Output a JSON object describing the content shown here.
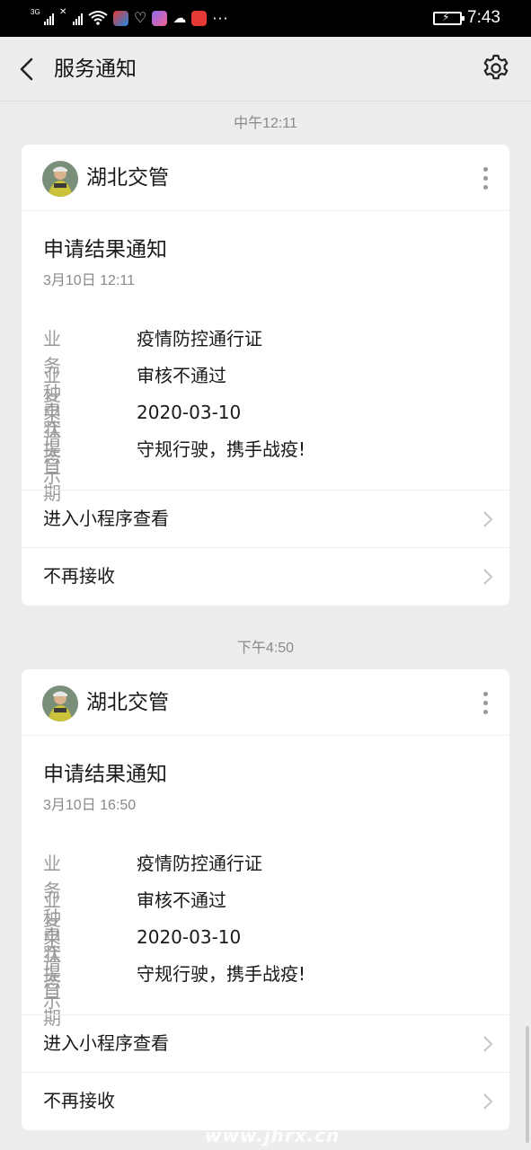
{
  "status_bar": {
    "network1": "3G",
    "network2": "4G",
    "time": "7:43",
    "more_glyph": "···"
  },
  "header": {
    "title": "服务通知",
    "back_icon": "back-chevron-icon",
    "settings_icon": "gear-icon"
  },
  "notifications": [
    {
      "timestamp": "中午12:11",
      "sender": "湖北交管",
      "title": "申请结果通知",
      "date": "3月10日  12:11",
      "fields": [
        {
          "key": "业务种类",
          "value": "疫情防控通行证"
        },
        {
          "key": "业务状态",
          "value": "审核不通过"
        },
        {
          "key": "申请日期",
          "value": "2020-03-10"
        },
        {
          "key": "提示",
          "value": "守规行驶，携手战疫!"
        }
      ],
      "action_view": "进入小程序查看",
      "action_unsubscribe": "不再接收"
    },
    {
      "timestamp": "下午4:50",
      "sender": "湖北交管",
      "title": "申请结果通知",
      "date": "3月10日  16:50",
      "fields": [
        {
          "key": "业务种类",
          "value": "疫情防控通行证"
        },
        {
          "key": "业务状态",
          "value": "审核不通过"
        },
        {
          "key": "申请日期",
          "value": "2020-03-10"
        },
        {
          "key": "提示",
          "value": "守规行驶，携手战疫!"
        }
      ],
      "action_view": "进入小程序查看",
      "action_unsubscribe": "不再接收"
    }
  ],
  "watermark": "www.jhrx.cn",
  "colors": {
    "background": "#ededed",
    "card": "#ffffff",
    "muted_text": "#9a9a9a",
    "status_bar": "#000000"
  }
}
